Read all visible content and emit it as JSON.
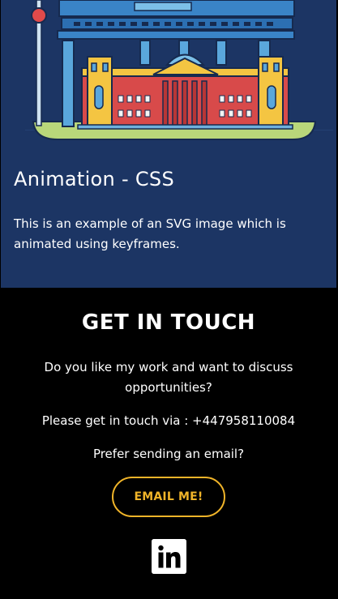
{
  "card": {
    "title": "Animation - CSS",
    "description": "This is an example of an SVG image which is animated using keyframes."
  },
  "contact": {
    "heading": "GET IN TOUCH",
    "question": "Do you like my work and want to discuss opportunities?",
    "phone_line": "Please get in touch via : +447958110084",
    "email_prompt": "Prefer sending an email?",
    "email_button": "EMAIL ME!",
    "linkedin_icon": "linkedin-icon"
  },
  "colors": {
    "card_bg": "#1c3564",
    "accent": "#f0b429",
    "footer_bg": "#000000"
  }
}
